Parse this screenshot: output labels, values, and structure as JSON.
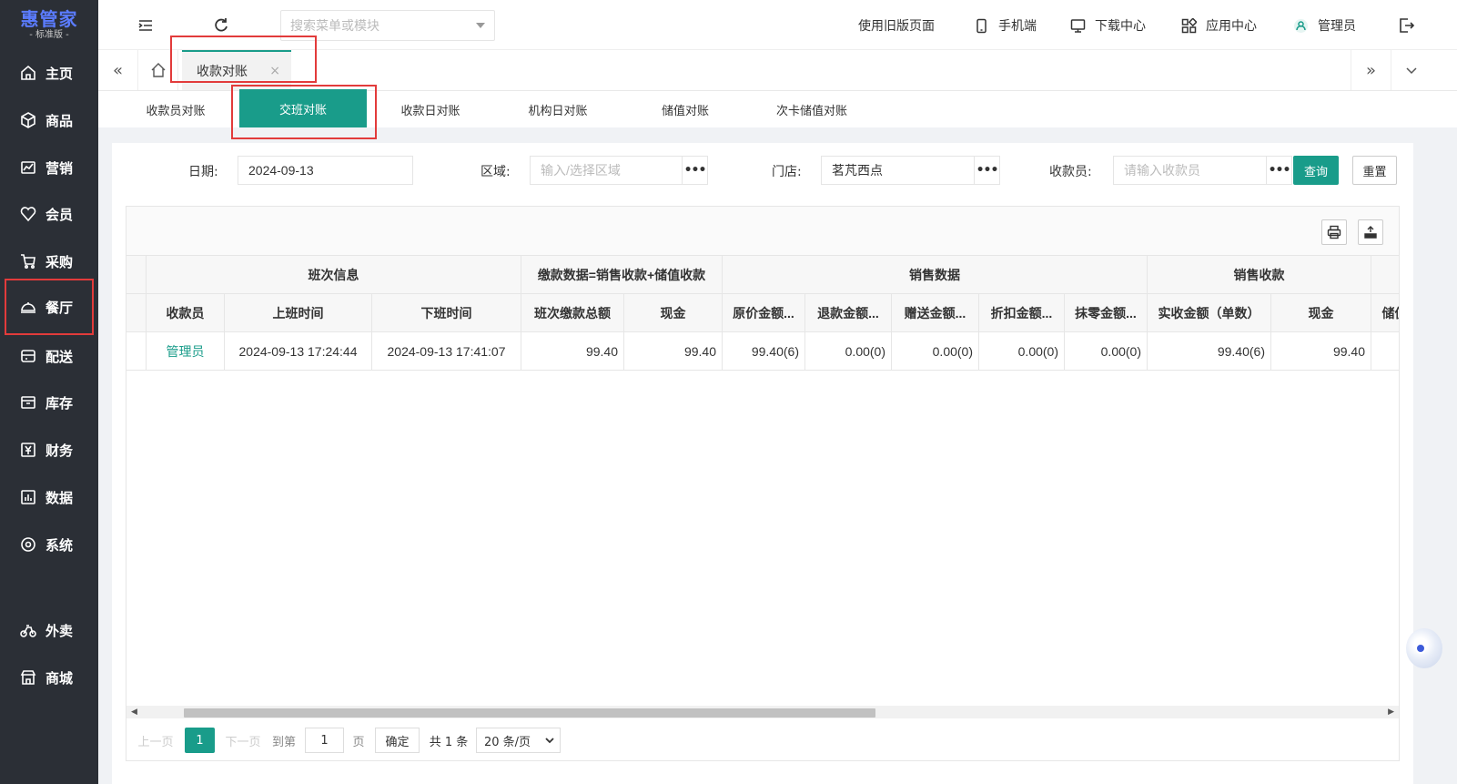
{
  "app": {
    "logo_title": "惠管家",
    "logo_subtitle": "- 标准版 -"
  },
  "sidebar": {
    "items": [
      {
        "label": "主页",
        "icon": "home-icon"
      },
      {
        "label": "商品",
        "icon": "box-icon"
      },
      {
        "label": "营销",
        "icon": "chart-icon"
      },
      {
        "label": "会员",
        "icon": "heart-icon"
      },
      {
        "label": "采购",
        "icon": "cart-icon"
      },
      {
        "label": "餐厅",
        "icon": "dish-icon"
      },
      {
        "label": "配送",
        "icon": "truck-icon"
      },
      {
        "label": "库存",
        "icon": "inventory-icon"
      },
      {
        "label": "财务",
        "icon": "yen-icon"
      },
      {
        "label": "数据",
        "icon": "data-icon"
      },
      {
        "label": "系统",
        "icon": "settings-icon"
      },
      {
        "label": "外卖",
        "icon": "bike-icon"
      },
      {
        "label": "商城",
        "icon": "shop-icon"
      }
    ]
  },
  "header": {
    "search_placeholder": "搜索菜单或模块",
    "links": {
      "old_page": "使用旧版页面",
      "mobile": "手机端",
      "download": "下载中心",
      "apps": "应用中心",
      "user": "管理员"
    }
  },
  "tabs": {
    "open_tab": "收款对账",
    "close_symbol": "×",
    "prev_symbol": "«",
    "next_symbol": "»"
  },
  "subtabs": [
    "收款员对账",
    "交班对账",
    "收款日对账",
    "机构日对账",
    "储值对账",
    "次卡储值对账"
  ],
  "filters": {
    "date_label": "日期:",
    "date_value": "2024-09-13",
    "region_label": "区域:",
    "region_placeholder": "输入/选择区域",
    "store_label": "门店:",
    "store_value": "茗芃西点",
    "cashier_label": "收款员:",
    "cashier_placeholder": "请输入收款员",
    "more": "•••",
    "query": "查询",
    "reset": "重置"
  },
  "table": {
    "group_headers": {
      "shift_info": "班次信息",
      "payment_data": "缴款数据=销售收款+储值收款",
      "sales_data": "销售数据",
      "sales_receipt": "销售收款"
    },
    "columns": [
      "收款员",
      "上班时间",
      "下班时间",
      "班次缴款总额",
      "现金",
      "原价金额...",
      "退款金额...",
      "赠送金额...",
      "折扣金额...",
      "抹零金额...",
      "实收金额（单数）",
      "现金",
      "储值"
    ],
    "rows": [
      [
        "管理员",
        "2024-09-13 17:24:44",
        "2024-09-13 17:41:07",
        "99.40",
        "99.40",
        "99.40(6)",
        "0.00(0)",
        "0.00(0)",
        "0.00(0)",
        "0.00(0)",
        "99.40(6)",
        "99.40",
        ""
      ]
    ]
  },
  "pager": {
    "prev": "上一页",
    "current": "1",
    "next": "下一页",
    "goto": "到第",
    "page_input": "1",
    "page_unit": "页",
    "confirm": "确定",
    "total": "共 1 条",
    "per_page": "20 条/页"
  }
}
